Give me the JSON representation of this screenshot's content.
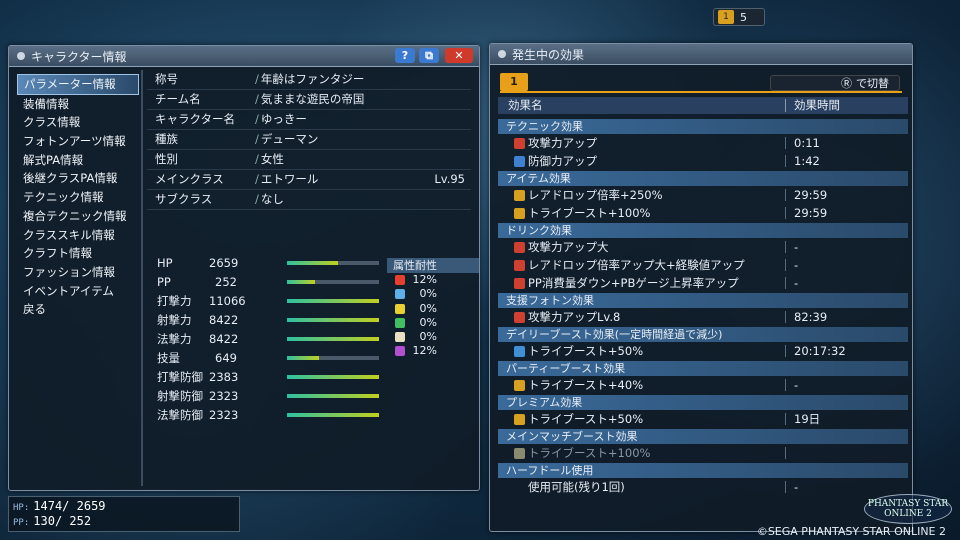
{
  "top_counter": {
    "value": "5"
  },
  "char_window": {
    "title": "キャラクター情報",
    "menu": [
      "パラメーター情報",
      "装備情報",
      "クラス情報",
      "フォトンアーツ情報",
      "解式PA情報",
      "後継クラスPA情報",
      "テクニック情報",
      "複合テクニック情報",
      "クラススキル情報",
      "クラフト情報",
      "ファッション情報",
      "イベントアイテム",
      "戻る"
    ],
    "info": [
      {
        "k": "称号",
        "v": "年齢はファンタジー"
      },
      {
        "k": "チーム名",
        "v": "気ままな遊民の帝国"
      },
      {
        "k": "キャラクター名",
        "v": "ゆっきー"
      },
      {
        "k": "種族",
        "v": "デューマン"
      },
      {
        "k": "性別",
        "v": "女性"
      },
      {
        "k": "メインクラス",
        "v": "エトワール",
        "lv": "Lv.95"
      },
      {
        "k": "サブクラス",
        "v": "なし"
      }
    ],
    "stats": [
      {
        "k": "HP",
        "n": "2659",
        "fill": 0.55
      },
      {
        "k": "PP",
        "n": "252",
        "fill": 0.3
      },
      {
        "k": "打撃力",
        "n": "11066",
        "fill": 1.0
      },
      {
        "k": "射撃力",
        "n": "8422",
        "fill": 1.0
      },
      {
        "k": "法撃力",
        "n": "8422",
        "fill": 1.0
      },
      {
        "k": "技量",
        "n": "649",
        "fill": 0.35
      },
      {
        "k": "打撃防御",
        "n": "2383",
        "fill": 1.0
      },
      {
        "k": "射撃防御",
        "n": "2323",
        "fill": 1.0
      },
      {
        "k": "法撃防御",
        "n": "2323",
        "fill": 1.0
      }
    ],
    "attr_title": "属性耐性",
    "attr": [
      {
        "c": "#e84030",
        "p": "12%"
      },
      {
        "c": "#60b0e8",
        "p": "0%"
      },
      {
        "c": "#e8d030",
        "p": "0%"
      },
      {
        "c": "#40c060",
        "p": "0%"
      },
      {
        "c": "#e8e0c0",
        "p": "0%"
      },
      {
        "c": "#b050d0",
        "p": "12%"
      }
    ]
  },
  "hp": {
    "label": "HP:",
    "value": "1474/ 2659"
  },
  "pp": {
    "label": "PP:",
    "value": "130/  252"
  },
  "eff_window": {
    "title": "発生中の効果",
    "tab": "1",
    "switch": "で切替",
    "col_name": "効果名",
    "col_time": "効果時間",
    "sections": [
      {
        "name": "テクニック効果",
        "rows": [
          {
            "n": "攻撃力アップ",
            "t": "0:11",
            "c": "#d04030"
          },
          {
            "n": "防御力アップ",
            "t": "1:42",
            "c": "#4080d0"
          }
        ]
      },
      {
        "name": "アイテム効果",
        "rows": [
          {
            "n": "レアドロップ倍率+250%",
            "t": "29:59",
            "c": "#d8a020"
          },
          {
            "n": "トライブースト+100%",
            "t": "29:59",
            "c": "#d8a020"
          }
        ]
      },
      {
        "name": "ドリンク効果",
        "rows": [
          {
            "n": "攻撃力アップ大",
            "t": "-",
            "c": "#d04030"
          },
          {
            "n": "レアドロップ倍率アップ大+経験値アップ",
            "t": "-",
            "c": "#d04030"
          },
          {
            "n": "PP消費量ダウン+PBゲージ上昇率アップ",
            "t": "-",
            "c": "#d04030"
          }
        ]
      },
      {
        "name": "支援フォトン効果",
        "rows": [
          {
            "n": "攻撃力アップLv.8",
            "t": "82:39",
            "c": "#d04030"
          }
        ]
      },
      {
        "name": "デイリーブースト効果(一定時間経過で減少)",
        "rows": [
          {
            "n": "トライブースト+50%",
            "t": "20:17:32",
            "c": "#4090d8"
          }
        ]
      },
      {
        "name": "パーティーブースト効果",
        "rows": [
          {
            "n": "トライブースト+40%",
            "t": "-",
            "c": "#d8a020"
          }
        ]
      },
      {
        "name": "プレミアム効果",
        "rows": [
          {
            "n": "トライブースト+50%",
            "t": "19日",
            "c": "#d8a020"
          }
        ]
      },
      {
        "name": "メインマッチブースト効果",
        "rows": [
          {
            "n": "トライブースト+100%",
            "t": "",
            "c": "#8a8a70",
            "dim": true
          }
        ]
      },
      {
        "name": "ハーフドール使用",
        "rows": [
          {
            "n": "使用可能(残り1回)",
            "t": "-",
            "c": ""
          }
        ]
      }
    ]
  },
  "copyright": "©SEGA PHANTASY STAR ONLINE 2",
  "logo_text": "PHANTASY STAR ONLINE 2"
}
